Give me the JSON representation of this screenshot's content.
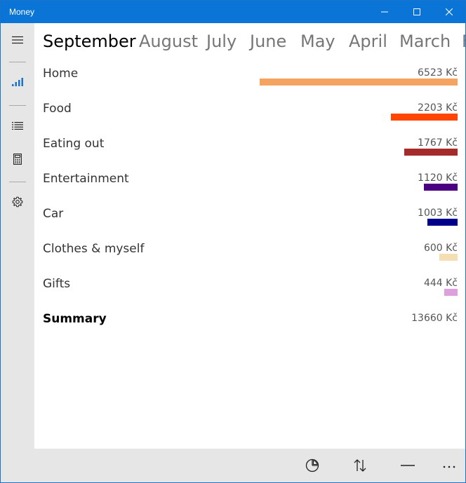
{
  "window": {
    "title": "Money"
  },
  "sidebar": {
    "items": [
      {
        "name": "menu"
      },
      {
        "name": "chart",
        "active": true
      },
      {
        "name": "list"
      },
      {
        "name": "calculator"
      },
      {
        "name": "settings"
      }
    ]
  },
  "months": [
    "September",
    "August",
    "July",
    "June",
    "May",
    "April",
    "March",
    "F"
  ],
  "selected_month": "September",
  "categories": [
    {
      "name": "Home",
      "amount": "6523 Kč",
      "value": 6523,
      "color": "#f4a460"
    },
    {
      "name": "Food",
      "amount": "2203 Kč",
      "value": 2203,
      "color": "#ff4500"
    },
    {
      "name": "Eating out",
      "amount": "1767 Kč",
      "value": 1767,
      "color": "#a52a2a"
    },
    {
      "name": "Entertainment",
      "amount": "1120 Kč",
      "value": 1120,
      "color": "#4b0082"
    },
    {
      "name": "Car",
      "amount": "1003 Kč",
      "value": 1003,
      "color": "#00008b"
    },
    {
      "name": "Clothes & myself",
      "amount": "600 Kč",
      "value": 600,
      "color": "#f5deb3"
    },
    {
      "name": "Gifts",
      "amount": "444 Kč",
      "value": 444,
      "color": "#dda0dd"
    }
  ],
  "summary": {
    "label": "Summary",
    "amount": "13660 Kč"
  },
  "commands": [
    {
      "name": "pie-chart"
    },
    {
      "name": "sort"
    },
    {
      "name": "minus"
    },
    {
      "name": "more"
    }
  ]
}
